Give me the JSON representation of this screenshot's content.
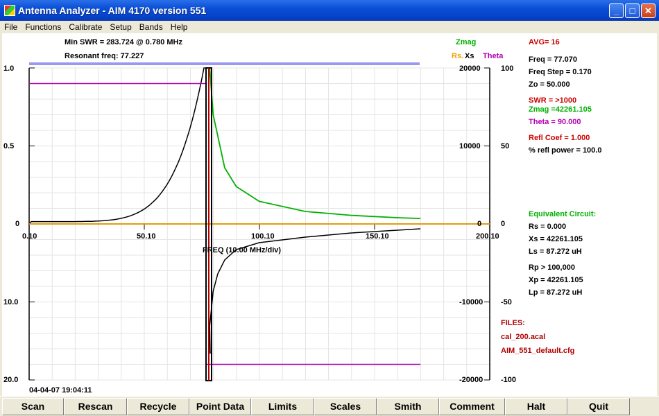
{
  "window": {
    "title": "Antenna Analyzer -   AIM 4170 version 551",
    "min": "_",
    "max": "□",
    "close": "✕"
  },
  "menu": [
    "File",
    "Functions",
    "Calibrate",
    "Setup",
    "Bands",
    "Help"
  ],
  "header": {
    "min_swr": "Min SWR =  283.724 @  0.780 MHz",
    "resonant": "Resonant freq:  77.227"
  },
  "legend": {
    "zmag": "Zmag",
    "rs": "Rs.",
    "xs": "Xs",
    "theta": "Theta"
  },
  "readout": {
    "avg": "AVG= 16",
    "freq": "Freq =  77.070",
    "freq_step": "Freq Step = 0.170",
    "zo": "Zo =  50.000",
    "swr": "SWR  = >1000",
    "zmag": "Zmag =42261.105",
    "theta": "Theta =  90.000",
    "refl": "Refl Coef   = 1.000",
    "pct": "% refl power = 100.0"
  },
  "equiv": {
    "title": "Equivalent Circuit:",
    "rs": "Rs =    0.000",
    "xs": "Xs = 42261.105",
    "ls": "Ls =   87.272  uH",
    "rp": "Rp > 100,000",
    "xp": "Xp = 42261.105",
    "lp": "Lp =   87.272  uH"
  },
  "files": {
    "title": "FILES:",
    "f1": "cal_200.acal",
    "f2": "AIM_551_default.cfg"
  },
  "timestamp": "04-04-07  19:04:11",
  "axes": {
    "xlabel": "FREQ (10.00 MHz/div)",
    "xticks": [
      "0.10",
      "50.10",
      "100.10",
      "150.10",
      "200.10"
    ],
    "left_top": [
      "1.0",
      "0.5",
      "0"
    ],
    "left_bottom": [
      "10.0",
      "20.0"
    ],
    "mid_ticks": [
      "20000",
      "10000",
      "0",
      "-10000",
      "-20000"
    ],
    "right_ticks": [
      "100",
      "50",
      "0",
      "-50",
      "-100"
    ]
  },
  "buttons": [
    "Scan",
    "Rescan",
    "Recycle",
    "Point Data",
    "Limits",
    "Scales",
    "Smith",
    "Comment",
    "Halt",
    "Quit"
  ],
  "colors": {
    "zmag": "#00b000",
    "rsxs": "#f0a000",
    "theta": "#b000b0",
    "refl": "#000000",
    "red": "#cc0000",
    "scanbar": "#9999ee"
  },
  "chart_data": {
    "type": "line",
    "x_range": [
      0.1,
      200.1
    ],
    "series": [
      {
        "name": "Zmag",
        "x": [
          78.5,
          80,
          85,
          90,
          100,
          120,
          140,
          160,
          170
        ],
        "y": [
          20000,
          14000,
          7200,
          4800,
          2900,
          1600,
          1100,
          800,
          700
        ]
      },
      {
        "name": "Xs",
        "x": [
          0.1,
          200.1
        ],
        "y": [
          0,
          0
        ]
      },
      {
        "name": "Theta",
        "x": [
          0.1,
          77.0,
          77.0,
          170
        ],
        "y": [
          90,
          90,
          -90,
          -90
        ]
      }
    ]
  }
}
